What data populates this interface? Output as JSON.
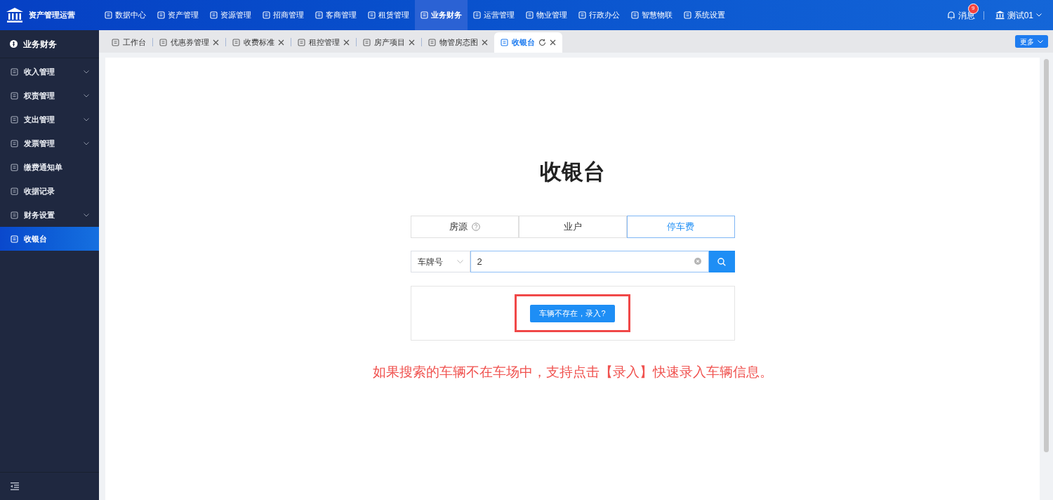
{
  "app": {
    "title": "资产管理运营"
  },
  "top_nav": [
    {
      "label": "数据中心",
      "selected": false
    },
    {
      "label": "资产管理",
      "selected": false
    },
    {
      "label": "资源管理",
      "selected": false
    },
    {
      "label": "招商管理",
      "selected": false
    },
    {
      "label": "客商管理",
      "selected": false
    },
    {
      "label": "租赁管理",
      "selected": false
    },
    {
      "label": "业务财务",
      "selected": true
    },
    {
      "label": "运营管理",
      "selected": false
    },
    {
      "label": "物业管理",
      "selected": false
    },
    {
      "label": "行政办公",
      "selected": false
    },
    {
      "label": "智慧物联",
      "selected": false
    },
    {
      "label": "系统设置",
      "selected": false
    }
  ],
  "header_right": {
    "messages": "消息",
    "badge": "9",
    "user": "测试01"
  },
  "sidebar": {
    "title": "业务财务",
    "items": [
      {
        "label": "收入管理",
        "expandable": true,
        "selected": false
      },
      {
        "label": "权责管理",
        "expandable": true,
        "selected": false
      },
      {
        "label": "支出管理",
        "expandable": true,
        "selected": false
      },
      {
        "label": "发票管理",
        "expandable": true,
        "selected": false
      },
      {
        "label": "缴费通知单",
        "expandable": false,
        "selected": false
      },
      {
        "label": "收据记录",
        "expandable": false,
        "selected": false
      },
      {
        "label": "财务设置",
        "expandable": true,
        "selected": false
      },
      {
        "label": "收银台",
        "expandable": false,
        "selected": true
      }
    ]
  },
  "page_tabs": [
    {
      "label": "工作台",
      "closable": false,
      "selected": false
    },
    {
      "label": "优惠券管理",
      "closable": true,
      "selected": false
    },
    {
      "label": "收费标准",
      "closable": true,
      "selected": false
    },
    {
      "label": "租控管理",
      "closable": true,
      "selected": false
    },
    {
      "label": "房产项目",
      "closable": true,
      "selected": false
    },
    {
      "label": "物管房态图",
      "closable": true,
      "selected": false
    },
    {
      "label": "收银台",
      "closable": true,
      "selected": true
    }
  ],
  "more_button": "更多",
  "main": {
    "title": "收银台",
    "segments": [
      {
        "label": "房源",
        "help": true,
        "selected": false
      },
      {
        "label": "业户",
        "help": false,
        "selected": false
      },
      {
        "label": "停车费",
        "help": false,
        "selected": true
      }
    ],
    "search": {
      "type": "车牌号",
      "value": "2"
    },
    "add_button": "车辆不存在，录入?",
    "note": "如果搜索的车辆不在车场中，支持点击【录入】快速录入车辆信息。"
  }
}
